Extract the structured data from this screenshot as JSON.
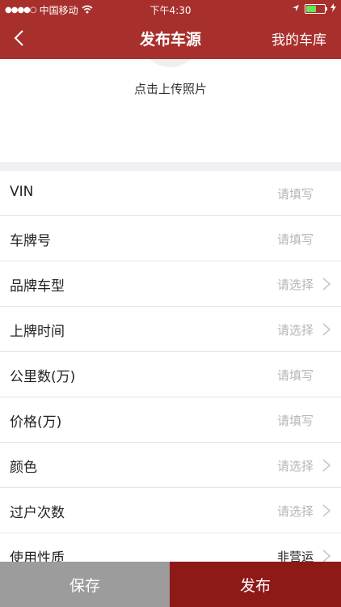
{
  "status_bar": {
    "signal": "●●●●○",
    "carrier": "中国移动",
    "time": "下午4:30"
  },
  "nav": {
    "title": "发布车源",
    "right_label": "我的车库"
  },
  "upload": {
    "label": "点击上传照片"
  },
  "form": {
    "rows": [
      {
        "label": "VIN",
        "value": "请填写"
      },
      {
        "label": "车牌号",
        "value": "请填写"
      },
      {
        "label": "品牌车型",
        "value": "请选择"
      },
      {
        "label": "上牌时间",
        "value": "请选择"
      },
      {
        "label": "公里数(万)",
        "value": "请填写"
      },
      {
        "label": "价格(万)",
        "value": "请填写"
      },
      {
        "label": "颜色",
        "value": "请选择"
      },
      {
        "label": "过户次数",
        "value": "请选择"
      },
      {
        "label": "使用性质",
        "value": "非营运"
      }
    ]
  },
  "footer": {
    "save_label": "保存",
    "publish_label": "发布"
  },
  "colors": {
    "brand": "#a8302c",
    "publish": "#8e1a18",
    "save": "#9c9c9c",
    "battery_fill": "#6fe15b"
  }
}
